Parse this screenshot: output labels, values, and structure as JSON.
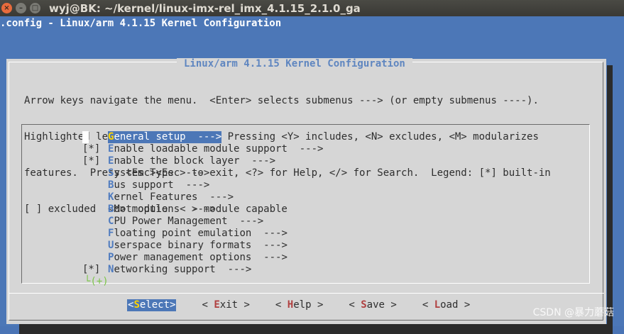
{
  "window": {
    "title": "wyj@BK: ~/kernel/linux-imx-rel_imx_4.1.15_2.1.0_ga",
    "close_glyph": "×",
    "min_glyph": "–",
    "max_glyph": "□"
  },
  "terminal_header": ".config - Linux/arm 4.1.15 Kernel Configuration",
  "dialog": {
    "title": "Linux/arm 4.1.15 Kernel Configuration",
    "help_lines": [
      "Arrow keys navigate the menu.  <Enter> selects submenus ---> (or empty submenus ----).",
      "Highlighted letters are hotkeys.  Pressing <Y> includes, <N> excludes, <M> modularizes",
      "features.  Press <Esc><Esc> to exit, <?> for Help, </> for Search.  Legend: [*] built-in",
      "[ ] excluded  <M> module  < > module capable"
    ]
  },
  "menu": {
    "items": [
      {
        "mark": "",
        "hot": "G",
        "rest": "eneral setup  --->",
        "selected": true
      },
      {
        "mark": "[*] ",
        "hot": "E",
        "rest": "nable loadable module support  --->"
      },
      {
        "mark": "[*] ",
        "hot": "E",
        "rest": "nable the block layer  --->"
      },
      {
        "mark": "",
        "hot": "S",
        "rest": "ystem Type  --->"
      },
      {
        "mark": "",
        "hot": "B",
        "rest": "us support  --->"
      },
      {
        "mark": "",
        "hot": "K",
        "rest": "ernel Features  --->"
      },
      {
        "mark": "",
        "hot": "B",
        "rest": "oot options  --->"
      },
      {
        "mark": "",
        "hot": "C",
        "rest": "PU Power Management  --->"
      },
      {
        "mark": "",
        "hot": "F",
        "rest": "loating point emulation  --->"
      },
      {
        "mark": "",
        "hot": "U",
        "rest": "serspace binary formats  --->"
      },
      {
        "mark": "",
        "hot": "P",
        "rest": "ower management options  --->"
      },
      {
        "mark": "[*] ",
        "hot": "N",
        "rest": "etworking support  --->"
      }
    ],
    "more_indicator": "└(+)"
  },
  "buttons": [
    {
      "open": "<",
      "hot": "S",
      "rest": "elect",
      "close": ">",
      "selected": true,
      "name": "select-button"
    },
    {
      "open": "< ",
      "hot": "E",
      "rest": "xit",
      "close": " >",
      "name": "exit-button"
    },
    {
      "open": "< ",
      "hot": "H",
      "rest": "elp",
      "close": " >",
      "name": "help-button"
    },
    {
      "open": "< ",
      "hot": "S",
      "rest": "ave",
      "close": " >",
      "name": "save-button"
    },
    {
      "open": "< ",
      "hot": "L",
      "rest": "oad",
      "close": " >",
      "name": "load-button"
    }
  ],
  "watermark": "CSDN @暴力蘑菇",
  "colors": {
    "terminal_bg": "#4c77b7",
    "dialog_bg": "#d6d6d6",
    "hotkey": "#4f7bbf",
    "selected_hotkey": "#ffd400",
    "button_hotkey": "#b04040",
    "more_indicator": "#7cc54a"
  }
}
